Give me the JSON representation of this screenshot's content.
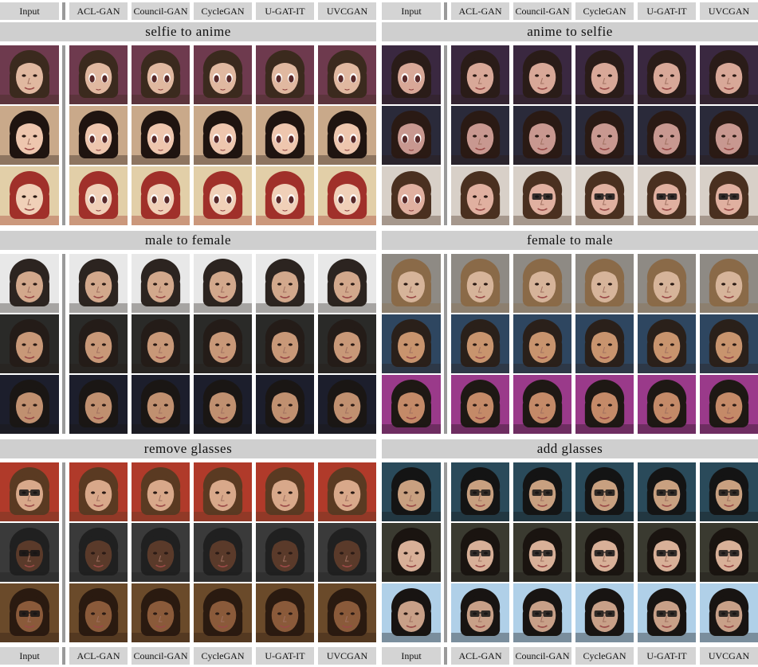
{
  "columns": [
    "Input",
    "ACL-GAN",
    "Council-GAN",
    "CycleGAN",
    "U-GAT-IT",
    "UVCGAN"
  ],
  "sections": [
    {
      "title": "selfie to anime",
      "style": "anime",
      "bg": [
        "#6e3a4e",
        "#c9a98a",
        "#e2cfa8"
      ],
      "hair": [
        "#3b2a1e",
        "#1f1410",
        "#a0302a"
      ],
      "skin": [
        "#e0b8a0",
        "#eec6ae",
        "#f0d0b8"
      ]
    },
    {
      "title": "anime to selfie",
      "style": "face",
      "bg": [
        "#3a2840",
        "#2a2a3a",
        "#d8d0c8"
      ],
      "hair": [
        "#2a1c18",
        "#2a1a14",
        "#4a3020"
      ],
      "skin": [
        "#d8a898",
        "#c89890",
        "#e0b0a0"
      ]
    },
    {
      "title": "male to female",
      "style": "face",
      "bg": [
        "#e8e8e8",
        "#2a2a28",
        "#1c1e2c"
      ],
      "hair": [
        "#2c2420",
        "#241c18",
        "#1a1614"
      ],
      "skin": [
        "#d2a88c",
        "#c89878",
        "#c09070"
      ]
    },
    {
      "title": "female to male",
      "style": "face",
      "bg": [
        "#8e8a84",
        "#2e4660",
        "#9a3a8a"
      ],
      "hair": [
        "#8a6a48",
        "#2a201a",
        "#1e1814"
      ],
      "skin": [
        "#d6b49a",
        "#c8946e",
        "#c48a68"
      ]
    },
    {
      "title": "remove glasses",
      "style": "face",
      "bg": [
        "#b03a2a",
        "#3a3a3a",
        "#6a4a2a"
      ],
      "hair": [
        "#5a3a22",
        "#202020",
        "#2a1a10"
      ],
      "skin": [
        "#d8a88a",
        "#5a3a2a",
        "#8a5a3a"
      ]
    },
    {
      "title": "add glasses",
      "style": "face",
      "bg": [
        "#2a4a5a",
        "#3a3a30",
        "#b0d0e8"
      ],
      "hair": [
        "#141414",
        "#1a1410",
        "#181412"
      ],
      "skin": [
        "#c8a080",
        "#d8b098",
        "#c8a088"
      ]
    }
  ]
}
